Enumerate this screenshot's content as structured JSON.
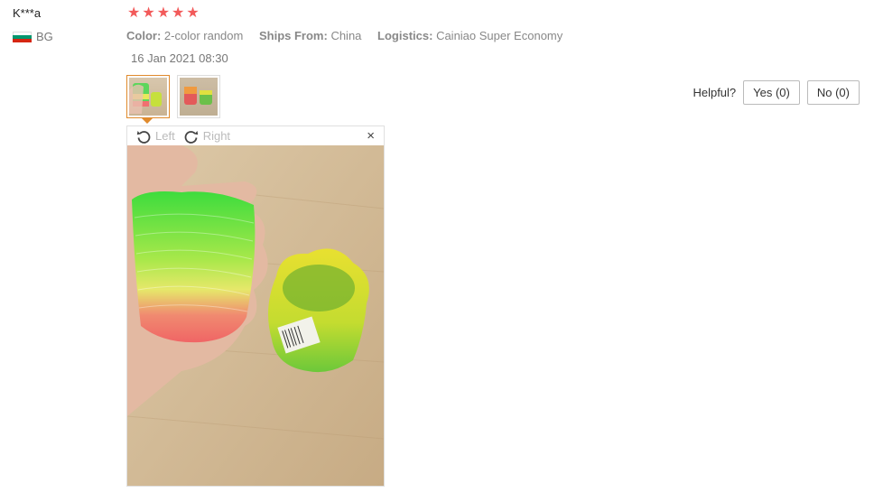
{
  "review": {
    "user_name": "K***a",
    "country_code": "BG",
    "rating": 5,
    "color_key": "Color:",
    "color_value": "2-color random",
    "ships_key": "Ships From:",
    "ships_value": "China",
    "logistics_key": "Logistics:",
    "logistics_value": "Cainiao Super Economy",
    "date": "16 Jan 2021 08:30"
  },
  "helpful": {
    "label": "Helpful?",
    "yes": "Yes (0)",
    "no": "No (0)"
  },
  "viewer": {
    "rotate_left": "Left",
    "rotate_right": "Right",
    "close": "×"
  },
  "icons": {
    "star": "star-icon",
    "rotate_left": "rotate-left-icon",
    "rotate_right": "rotate-right-icon",
    "close": "close-icon",
    "flag": "bulgaria-flag-icon"
  },
  "colors": {
    "star": "#f25a5a",
    "active_border": "#e08a2c",
    "flag": [
      "#ffffff",
      "#00966e",
      "#d62612"
    ]
  }
}
